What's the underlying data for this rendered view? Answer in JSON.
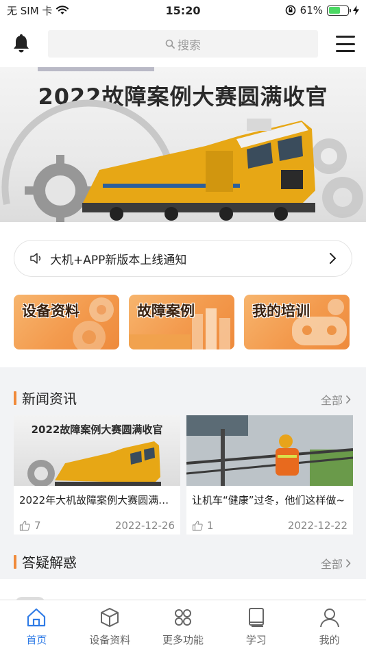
{
  "status_bar": {
    "carrier": "无 SIM 卡",
    "time": "15:20",
    "battery": "61%",
    "battery_level": 0.61
  },
  "header": {
    "search_placeholder": "搜索"
  },
  "banner": {
    "title": "2022故障案例大赛圆满收官"
  },
  "notice": {
    "text": "大机+APP新版本上线通知"
  },
  "quick_entries": [
    {
      "label": "设备资料"
    },
    {
      "label": "故障案例"
    },
    {
      "label": "我的培训"
    }
  ],
  "news": {
    "title": "新闻资讯",
    "more": "全部",
    "items": [
      {
        "title": "2022年大机故障案例大赛圆满…",
        "thumb_title": "2022故障案例大赛圆满收官",
        "likes": "7",
        "date": "2022-12-26"
      },
      {
        "title": "让机车“健康”过冬，他们这样做~",
        "likes": "1",
        "date": "2022-12-22"
      }
    ]
  },
  "qa": {
    "title": "答疑解惑",
    "more": "全部"
  },
  "tabbar": [
    {
      "label": "首页",
      "icon": "home-icon",
      "active": true
    },
    {
      "label": "设备资料",
      "icon": "cube-icon",
      "active": false
    },
    {
      "label": "更多功能",
      "icon": "grid-icon",
      "active": false
    },
    {
      "label": "学习",
      "icon": "book-icon",
      "active": false
    },
    {
      "label": "我的",
      "icon": "user-icon",
      "active": false
    }
  ],
  "colors": {
    "accent": "#2f7be6",
    "orange": "#f08a3a",
    "background": "#f2f3f5"
  }
}
